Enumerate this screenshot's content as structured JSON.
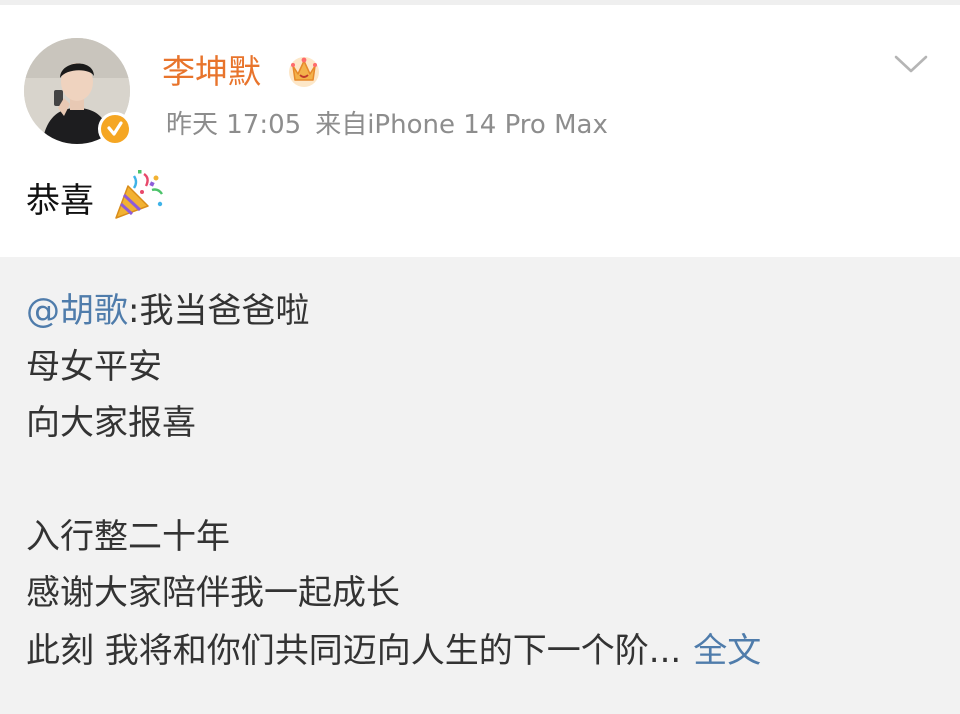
{
  "post": {
    "author_name": "李坤默",
    "time": "昨天 17:05",
    "source": "来自iPhone 14 Pro Max",
    "text": "恭喜",
    "emoji": "party-popper-icon"
  },
  "repost": {
    "mention": "@胡歌",
    "line1_rest": ":我当爸爸啦",
    "line2": "母女平安",
    "line3": "向大家报喜",
    "line4": "入行整二十年",
    "line5": "感谢大家陪伴我一起成长",
    "line6": "此刻 我将和你们共同迈向人生的下一个阶...",
    "more_label": "全文"
  },
  "colors": {
    "author": "#e8742c",
    "link": "#4f7cab",
    "meta": "#8d8d8d",
    "repost_bg": "#f2f2f2",
    "verified_badge": "#f5a623"
  }
}
